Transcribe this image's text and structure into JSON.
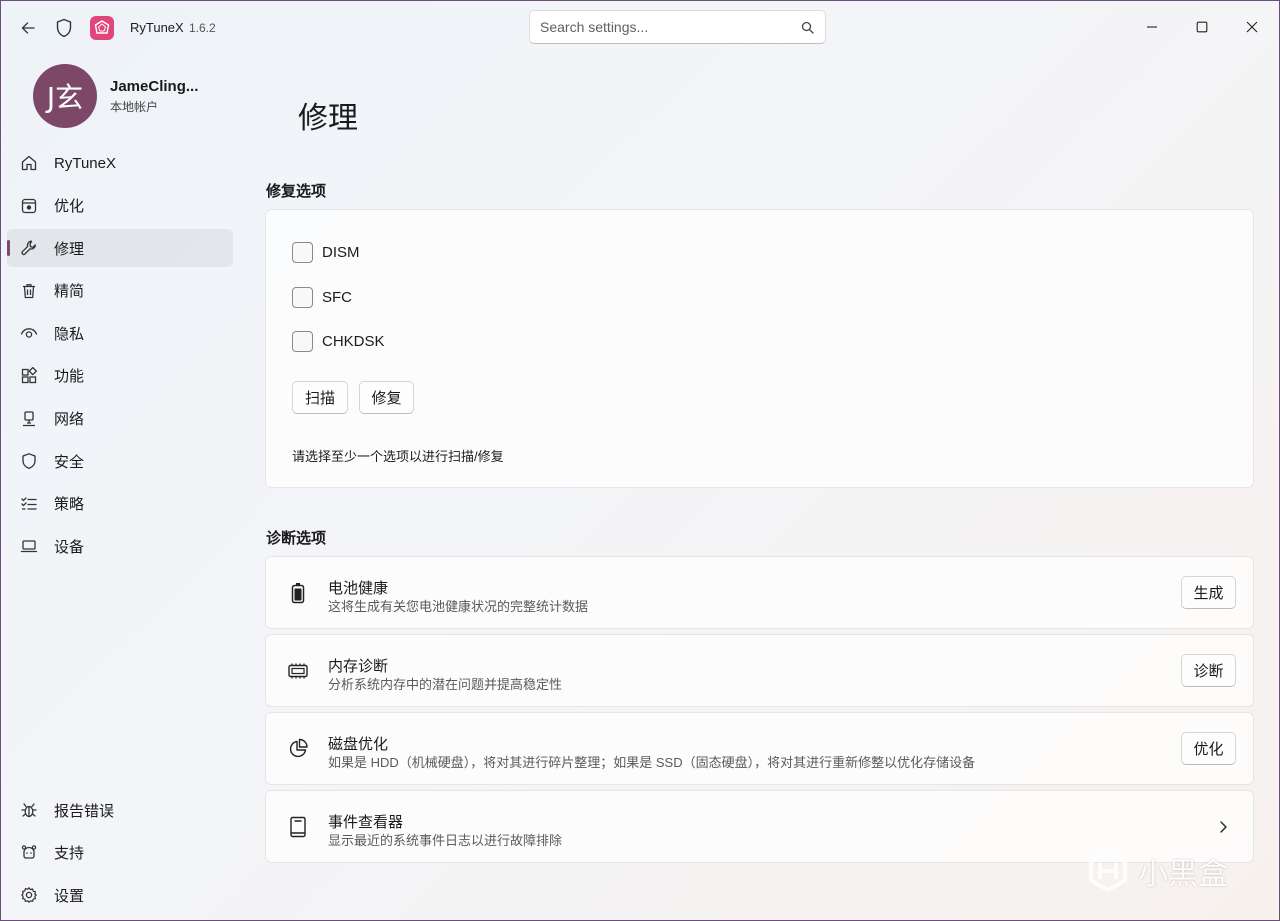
{
  "app": {
    "title": "RyTuneX",
    "version": "1.6.2"
  },
  "search": {
    "placeholder": "Search settings..."
  },
  "profile": {
    "initials": "J玄",
    "name": "JameCling...",
    "account_type": "本地帐户"
  },
  "nav": {
    "items": [
      {
        "label": "RyTuneX",
        "icon": "home-icon"
      },
      {
        "label": "优化",
        "icon": "optimize-icon"
      },
      {
        "label": "修理",
        "icon": "wrench-icon",
        "active": true
      },
      {
        "label": "精简",
        "icon": "trash-icon"
      },
      {
        "label": "隐私",
        "icon": "eye-icon"
      },
      {
        "label": "功能",
        "icon": "apps-icon"
      },
      {
        "label": "网络",
        "icon": "network-icon"
      },
      {
        "label": "安全",
        "icon": "shield-icon"
      },
      {
        "label": "策略",
        "icon": "policy-list-icon"
      },
      {
        "label": "设备",
        "icon": "laptop-icon"
      }
    ],
    "footer": [
      {
        "label": "报告错误",
        "icon": "bug-icon"
      },
      {
        "label": "支持",
        "icon": "support-icon"
      },
      {
        "label": "设置",
        "icon": "gear-icon"
      }
    ]
  },
  "page": {
    "title": "修理"
  },
  "repair": {
    "section_title": "修复选项",
    "options": [
      "DISM",
      "SFC",
      "CHKDSK"
    ],
    "scan_label": "扫描",
    "repair_label": "修复",
    "hint": "请选择至少一个选项以进行扫描/修复"
  },
  "diagnostics": {
    "section_title": "诊断选项",
    "items": [
      {
        "title": "电池健康",
        "desc": "这将生成有关您电池健康状况的完整统计数据",
        "button": "生成",
        "icon": "battery-icon"
      },
      {
        "title": "内存诊断",
        "desc": "分析系统内存中的潜在问题并提高稳定性",
        "button": "诊断",
        "icon": "memory-icon"
      },
      {
        "title": "磁盘优化",
        "desc": "如果是 HDD（机械硬盘），将对其进行碎片整理；如果是 SSD（固态硬盘），将对其进行重新修整以优化存储设备",
        "button": "优化",
        "icon": "pie-chart-icon"
      },
      {
        "title": "事件查看器",
        "desc": "显示最近的系统事件日志以进行故障排除",
        "icon": "book-icon"
      }
    ]
  },
  "watermark": {
    "text": "小黑盒"
  },
  "colors": {
    "accent": "#7d4868",
    "app_logo": "#e0457b"
  }
}
